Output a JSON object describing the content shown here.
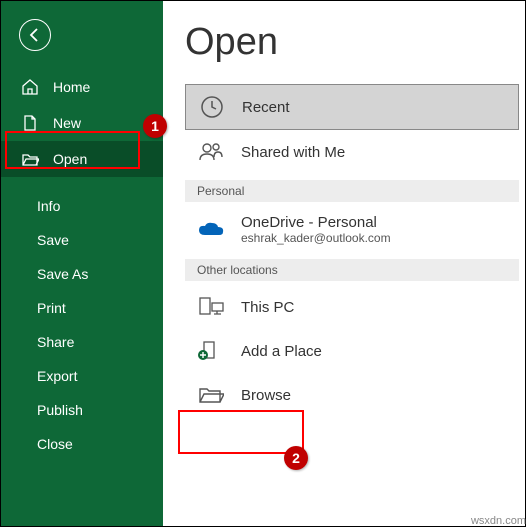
{
  "sidebar": {
    "items": [
      {
        "label": "Home"
      },
      {
        "label": "New"
      },
      {
        "label": "Open"
      },
      {
        "label": "Info"
      },
      {
        "label": "Save"
      },
      {
        "label": "Save As"
      },
      {
        "label": "Print"
      },
      {
        "label": "Share"
      },
      {
        "label": "Export"
      },
      {
        "label": "Publish"
      },
      {
        "label": "Close"
      }
    ]
  },
  "main": {
    "title": "Open",
    "recent": "Recent",
    "shared": "Shared with Me",
    "section_personal": "Personal",
    "onedrive_title": "OneDrive - Personal",
    "onedrive_email": "eshrak_kader@outlook.com",
    "section_other": "Other locations",
    "this_pc": "This PC",
    "add_place": "Add a Place",
    "browse": "Browse"
  },
  "callouts": {
    "c1": "1",
    "c2": "2"
  },
  "watermark": "wsxdn.com"
}
